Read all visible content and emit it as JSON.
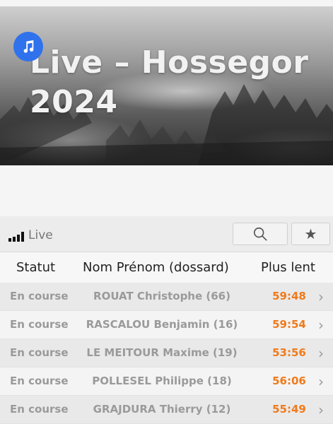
{
  "hero": {
    "title": "Live – Hossegor 2024",
    "badge_icon": "music-note-icon",
    "badge_color": "#2f72ec"
  },
  "toolbar": {
    "live_label": "Live",
    "live_icon": "signal-bars-icon",
    "search_icon": "search-icon",
    "favorites_icon": "star-icon"
  },
  "table": {
    "columns": [
      "Statut",
      "Nom Prénom (dossard)",
      "Plus lent"
    ],
    "rows": [
      {
        "status": "En course",
        "name": "ROUAT Christophe (66)",
        "time": "59:48"
      },
      {
        "status": "En course",
        "name": "RASCALOU Benjamin (16)",
        "time": "59:54"
      },
      {
        "status": "En course",
        "name": "LE MEITOUR Maxime (19)",
        "time": "53:56"
      },
      {
        "status": "En course",
        "name": "POLLESEL Philippe (18)",
        "time": "56:06"
      },
      {
        "status": "En course",
        "name": "GRAJDURA Thierry (12)",
        "time": "55:49"
      }
    ],
    "row_chevron": "›",
    "time_color": "#f07a1a"
  }
}
